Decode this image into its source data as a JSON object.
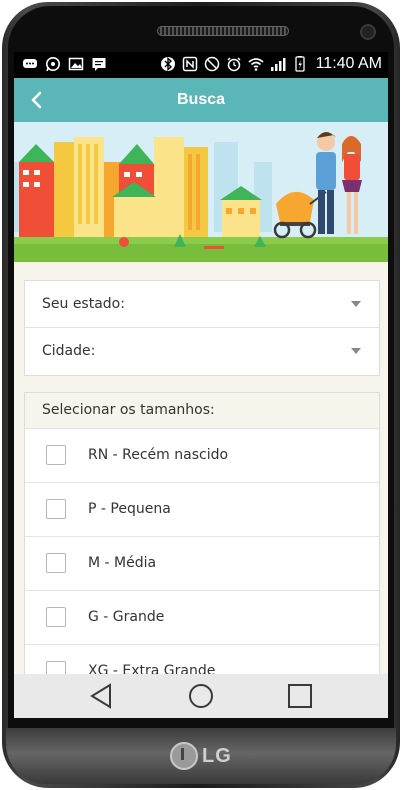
{
  "status_bar": {
    "time": "11:40 AM",
    "left_icons": [
      "messenger-icon",
      "whatsapp-icon",
      "gallery-icon",
      "message-icon"
    ],
    "right_icons": [
      "bluetooth-icon",
      "nfc-icon",
      "mute-icon",
      "alarm-icon",
      "wifi-icon",
      "signal-icon",
      "battery-icon"
    ]
  },
  "app_bar": {
    "title": "Busca",
    "background_color": "#5bb7b7",
    "back_icon": "chevron-left-icon"
  },
  "form": {
    "state_label": "Seu estado:",
    "city_label": "Cidade:"
  },
  "sizes": {
    "header": "Selecionar os tamanhos:",
    "items": [
      {
        "label": "RN - Recém nascido",
        "checked": false
      },
      {
        "label": "P - Pequena",
        "checked": false
      },
      {
        "label": "M - Média",
        "checked": false
      },
      {
        "label": "G - Grande",
        "checked": false
      },
      {
        "label": "XG - Extra Grande",
        "checked": false
      }
    ]
  },
  "nav_bar": {
    "back_icon": "triangle-back-icon",
    "home_icon": "circle-home-icon",
    "recents_icon": "square-recents-icon"
  },
  "device": {
    "brand_logo": "LG"
  }
}
